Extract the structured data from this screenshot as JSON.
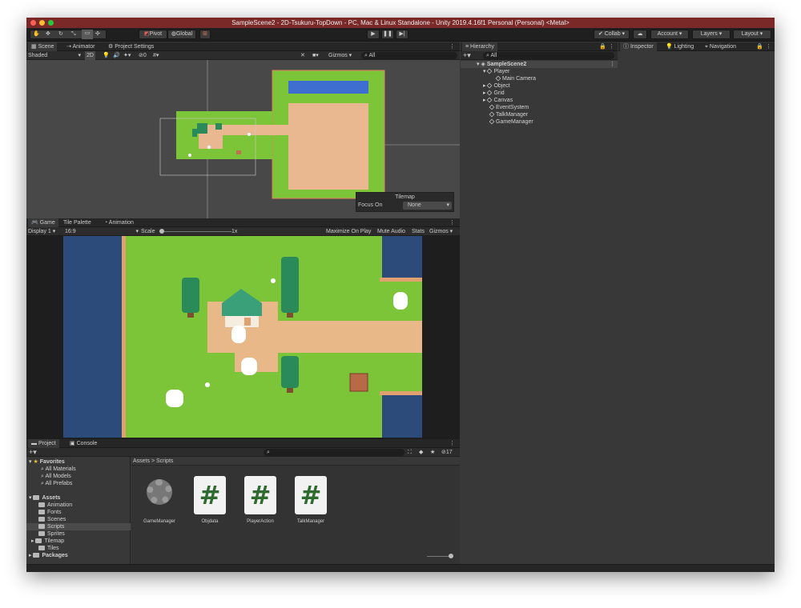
{
  "window": {
    "title": "SampleScene2 - 2D-Tsukuru-TopDown - PC, Mac & Linux Standalone - Unity 2019.4.16f1 Personal (Personal) <Metal>"
  },
  "toolbar": {
    "pivot": "Pivot",
    "global": "Global",
    "collab": "Collab",
    "account": "Account",
    "layers": "Layers",
    "layout": "Layout"
  },
  "scene_tabs": [
    "Scene",
    "Animator",
    "Project Settings"
  ],
  "scene_toolbar": {
    "shading": "Shaded",
    "mode_2d": "2D",
    "gizmos": "Gizmos",
    "search": "All",
    "hidden_count": "0"
  },
  "tilemap_overlay": {
    "title": "Tilemap",
    "focus_label": "Focus On",
    "focus_value": "None"
  },
  "game_tabs": [
    "Game",
    "Tile Palette",
    "Animation"
  ],
  "game_toolbar": {
    "display": "Display 1",
    "aspect": "16:9",
    "scale_label": "Scale",
    "scale_value": "1x",
    "maximize": "Maximize On Play",
    "mute": "Mute Audio",
    "stats": "Stats",
    "gizmos": "Gizmos"
  },
  "hierarchy": {
    "tab": "Hierarchy",
    "search": "All",
    "scene": "SampleScene2",
    "items": [
      "Player",
      "Main Camera",
      "Object",
      "Grid",
      "Canvas",
      "EventSystem",
      "TalkManager",
      "GameManager"
    ]
  },
  "inspector_tabs": [
    "Inspector",
    "Lighting",
    "Navigation"
  ],
  "project": {
    "tabs": [
      "Project",
      "Console"
    ],
    "favorites": {
      "label": "Favorites",
      "items": [
        "All Materials",
        "All Models",
        "All Prefabs"
      ]
    },
    "assets": {
      "label": "Assets",
      "items": [
        "Animation",
        "Fonts",
        "Scenes",
        "Scripts",
        "Sprites",
        "Tilemap",
        "Tiles"
      ]
    },
    "packages": "Packages",
    "breadcrumb": [
      "Assets",
      "Scripts"
    ],
    "files": [
      {
        "name": "GameManager",
        "icon": "gear-icon"
      },
      {
        "name": "Objdata",
        "icon": "csharp-script-icon",
        "glyph": "#"
      },
      {
        "name": "PlayerAction",
        "icon": "csharp-script-icon",
        "glyph": "#"
      },
      {
        "name": "TalkManager",
        "icon": "csharp-script-icon",
        "glyph": "#"
      }
    ],
    "hidden_count": "17"
  },
  "colors": {
    "titlebar": "#7a2828",
    "grass": "#7cc438",
    "path": "#e8b888",
    "water": "#2c4a7a",
    "panel": "#383838"
  }
}
